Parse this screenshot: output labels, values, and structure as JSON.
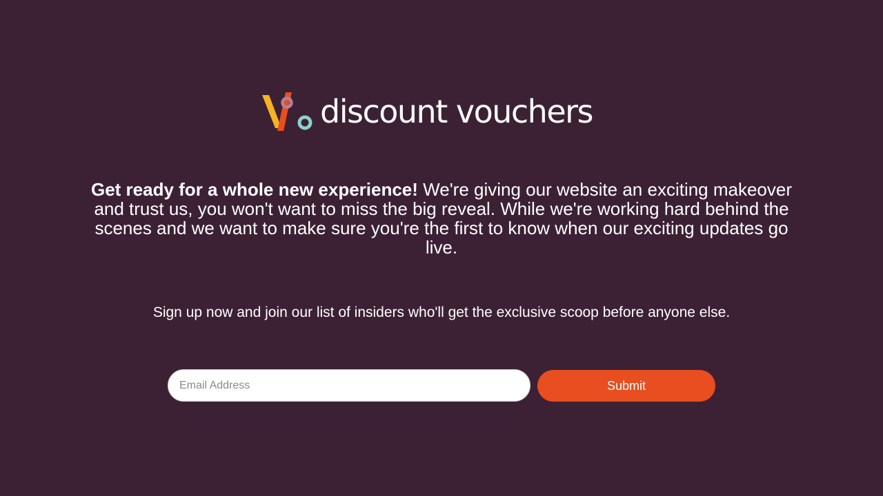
{
  "brand": {
    "name": "discount vouchers",
    "logo_icon": "percent-logo-icon",
    "colors": {
      "background": "#3c2134",
      "accent_orange": "#e84e1f",
      "logo_yellow": "#f6b323",
      "logo_pink": "#b07fa0",
      "logo_teal": "#8fd0cc"
    }
  },
  "intro": {
    "headline": "Get ready for a whole new experience!",
    "body": " We're giving our website an exciting makeover and trust us, you won't want to miss the big reveal. While we're working hard behind the scenes and we want to make sure you're the first to know when our exciting updates go live."
  },
  "signup": {
    "text": "Sign up now and join our list of insiders who'll get the exclusive scoop before anyone else."
  },
  "form": {
    "email_placeholder": "Email Address",
    "email_value": "",
    "submit_label": "Submit"
  }
}
